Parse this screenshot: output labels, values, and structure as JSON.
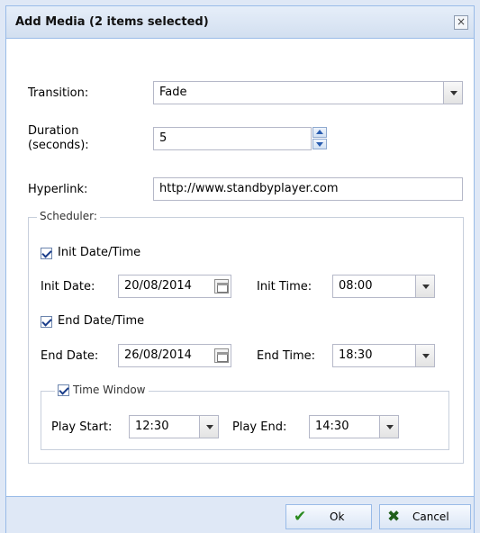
{
  "dialog": {
    "title": "Add Media (2 items selected)",
    "close_glyph": "×"
  },
  "form": {
    "transition_label": "Transition:",
    "transition_value": "Fade",
    "duration_label_line1": "Duration",
    "duration_label_line2": "(seconds):",
    "duration_value": "5",
    "hyperlink_label": "Hyperlink:",
    "hyperlink_value": "http://www.standbyplayer.com"
  },
  "scheduler": {
    "legend": "Scheduler:",
    "init_check_label": "Init Date/Time",
    "init_checked": true,
    "init_date_label": "Init Date:",
    "init_date_value": "20/08/2014",
    "init_time_label": "Init Time:",
    "init_time_value": "08:00",
    "end_check_label": "End Date/Time",
    "end_checked": true,
    "end_date_label": "End Date:",
    "end_date_value": "26/08/2014",
    "end_time_label": "End Time:",
    "end_time_value": "18:30",
    "time_window": {
      "legend": "Time Window",
      "checked": true,
      "play_start_label": "Play Start:",
      "play_start_value": "12:30",
      "play_end_label": "Play End:",
      "play_end_value": "14:30"
    }
  },
  "footer": {
    "ok_label": "Ok",
    "ok_glyph": "✔",
    "cancel_label": "Cancel",
    "cancel_glyph": "✖"
  },
  "colors": {
    "ok_icon": "#2a8a1e",
    "cancel_icon": "#1f5e1a"
  }
}
